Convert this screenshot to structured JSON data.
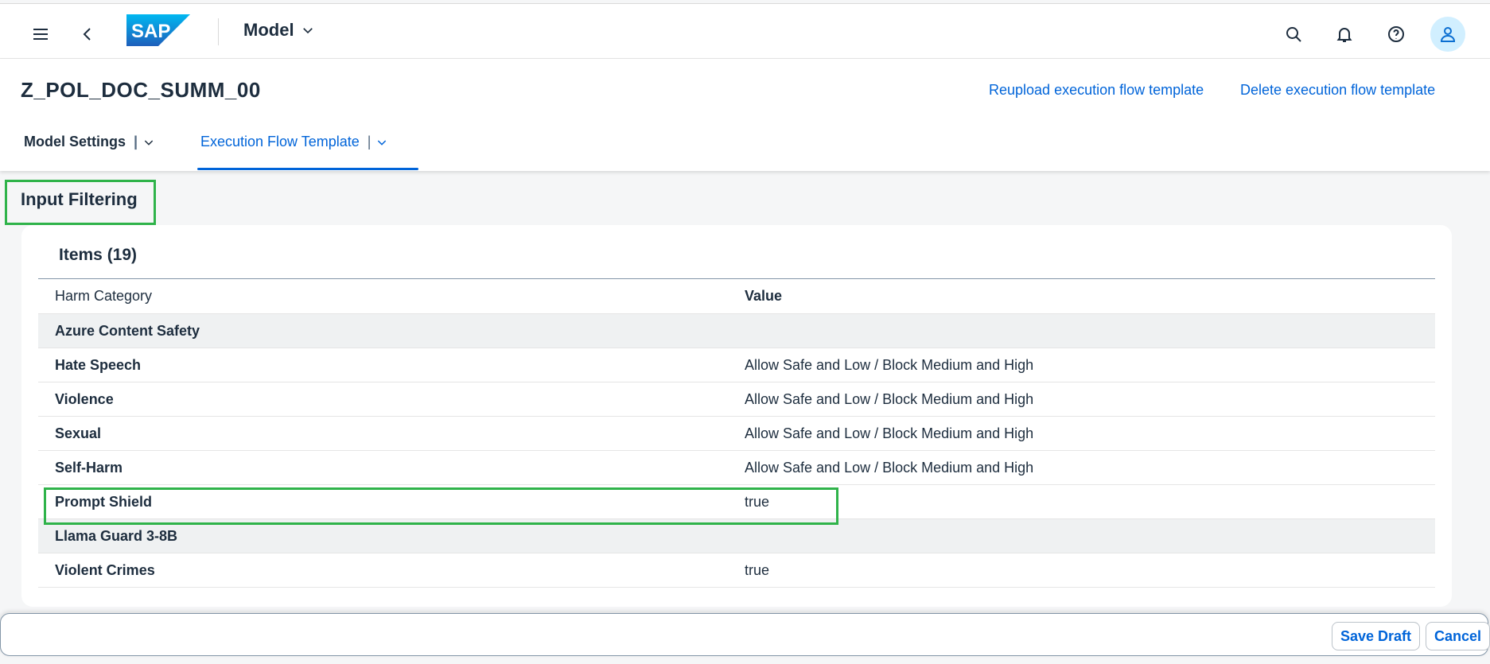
{
  "shell": {
    "brand": "SAP",
    "app_menu_label": "Model",
    "icons": [
      "menu-icon",
      "back-icon",
      "search-icon",
      "bell-icon",
      "help-icon",
      "user-icon"
    ]
  },
  "object_header": {
    "title": "Z_POL_DOC_SUMM_00",
    "actions": {
      "reupload": "Reupload execution flow template",
      "delete": "Delete execution flow template"
    },
    "tabs": [
      {
        "label": "Model Settings",
        "selected": false
      },
      {
        "label": "Execution Flow Template",
        "selected": true
      }
    ]
  },
  "section": {
    "title": "Input Filtering"
  },
  "table": {
    "title": "Items (19)",
    "columns": [
      "Harm Category",
      "Value"
    ],
    "rows": [
      {
        "type": "group",
        "category": "Azure Content Safety",
        "value": ""
      },
      {
        "type": "item",
        "category": "Hate Speech",
        "value": "Allow Safe and Low / Block Medium and High"
      },
      {
        "type": "item",
        "category": "Violence",
        "value": "Allow Safe and Low / Block Medium and High"
      },
      {
        "type": "item",
        "category": "Sexual",
        "value": "Allow Safe and Low / Block Medium and High"
      },
      {
        "type": "item",
        "category": "Self-Harm",
        "value": "Allow Safe and Low / Block Medium and High"
      },
      {
        "type": "item",
        "category": "Prompt Shield",
        "value": "true"
      },
      {
        "type": "group",
        "category": "Llama Guard 3-8B",
        "value": ""
      },
      {
        "type": "item",
        "category": "Violent Crimes",
        "value": "true"
      }
    ]
  },
  "footer": {
    "save_draft": "Save Draft",
    "cancel": "Cancel"
  },
  "colors": {
    "accent": "#0064d9",
    "highlight": "#2fb34a",
    "group_row": "#eff1f2"
  }
}
